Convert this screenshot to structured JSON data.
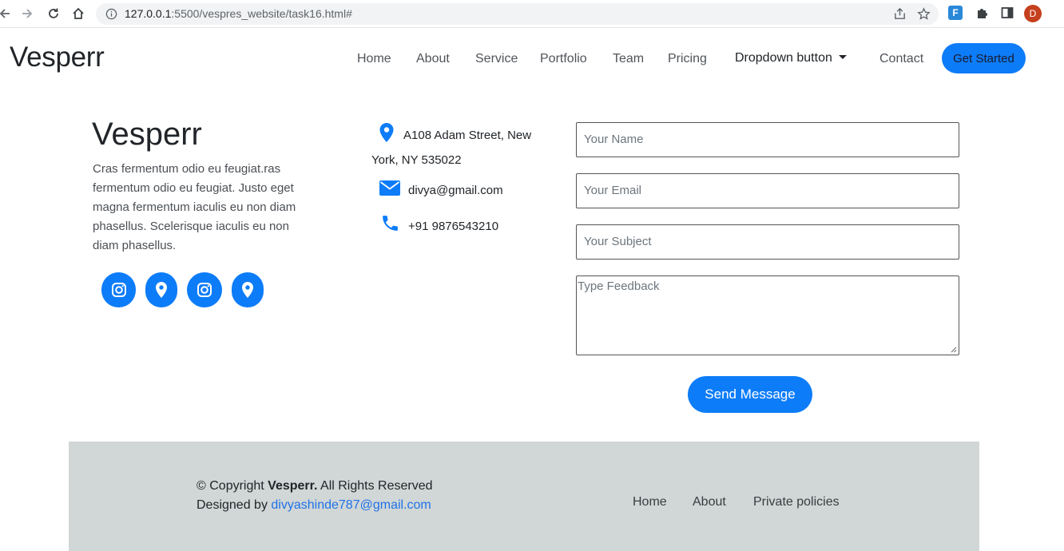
{
  "browser": {
    "url_host": "127.0.0.1",
    "url_path": ":5500/vespres_website/task16.html#",
    "profile_initial": "D",
    "ext_label": "F"
  },
  "navbar": {
    "brand": "Vesperr",
    "items": [
      "Home",
      "About",
      "Service",
      "Portfolio",
      "Team",
      "Pricing"
    ],
    "dropdown_label": "Dropdown button",
    "contact": "Contact",
    "cta": "Get Started"
  },
  "about": {
    "title": "Vesperr",
    "text_lines": [
      "Cras fermentum odio eu feugiat.ras",
      "fermentum odio eu feugiat. Justo eget",
      "magna fermentum iaculis eu non diam",
      "phasellus. Scelerisque iaculis eu non",
      "diam phasellus."
    ],
    "social_icons": [
      "instagram-icon",
      "map-marker-icon",
      "instagram-icon",
      "map-marker-icon"
    ]
  },
  "contact_info": {
    "address_line1": "A108 Adam Street, New",
    "address_line2": "York, NY 535022",
    "email": "divya@gmail.com",
    "phone": "+91 9876543210"
  },
  "form": {
    "name_placeholder": "Your Name",
    "email_placeholder": "Your Email",
    "subject_placeholder": "Your Subject",
    "feedback_placeholder": "Type Feedback",
    "submit_label": "Send Message"
  },
  "footer": {
    "copyright_prefix": "© Copyright",
    "copyright_brand": "Vesperr.",
    "copyright_suffix": "All Rights Reserved",
    "designed_by": "Designed by",
    "designer_email": "divyashinde787@gmail.com",
    "links": [
      "Home",
      "About",
      "Private policies"
    ]
  },
  "colors": {
    "accent": "#0d7cf8",
    "footer_bg": "#d1d6d6",
    "link": "#1f73e8"
  }
}
